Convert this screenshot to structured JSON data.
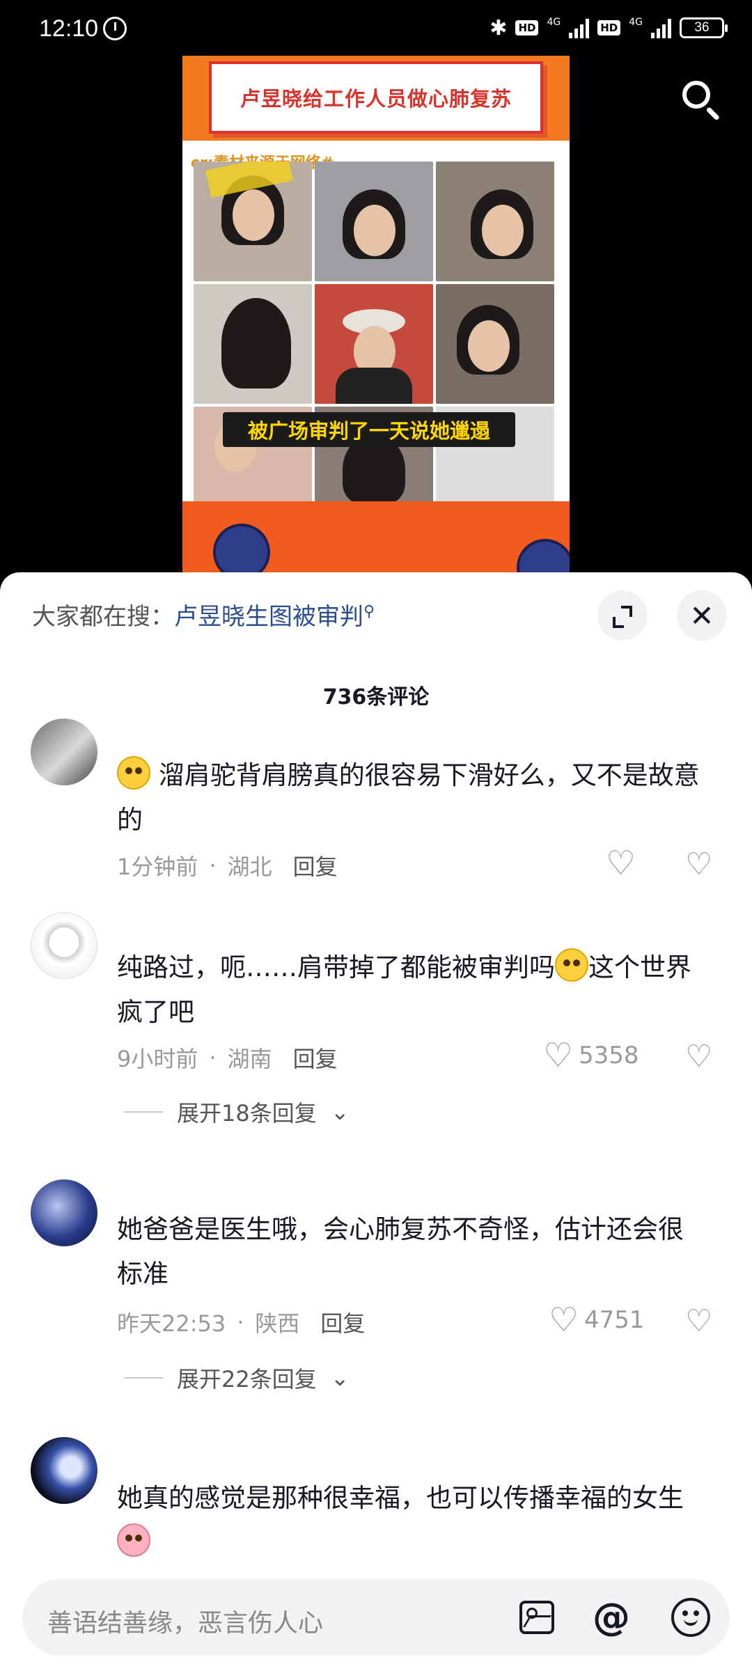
{
  "status_bar": {
    "time": "12:10",
    "network": "4G",
    "hd": "HD",
    "battery": "36"
  },
  "video": {
    "poster_title": "卢昱晓给工作人员做心肺复苏",
    "credit": "cr:素材来源于网络#",
    "caption": "被广场审判了一天说她邋遢"
  },
  "sheet": {
    "hot_search_prefix": "大家都在搜：",
    "hot_search_keyword": "卢昱晓生图被审判",
    "comment_count": "736条评论"
  },
  "comments": [
    {
      "text": "溜肩驼背肩膀真的很容易下滑好么，又不是故意的",
      "time": "1分钟前",
      "location": "湖北",
      "reply_label": "回复",
      "likes": ""
    },
    {
      "text_a": "纯路过，呃……肩带掉了都能被审判吗",
      "text_b": "这个世界疯了吧",
      "time": "9小时前",
      "location": "湖南",
      "reply_label": "回复",
      "likes": "5358",
      "expand": "展开18条回复"
    },
    {
      "text": "她爸爸是医生哦，会心肺复苏不奇怪，估计还会很标准",
      "time": "昨天22:53",
      "location": "陕西",
      "reply_label": "回复",
      "likes": "4751",
      "expand": "展开22条回复"
    },
    {
      "text": "她真的感觉是那种很幸福，也可以传播幸福的女生"
    }
  ],
  "input": {
    "placeholder": "善语结善缘，恶言伤人心"
  },
  "colors": {
    "accent_orange": "#f47a1f",
    "keyword_blue": "#2a4e8c",
    "sheet_bg": "#ffffff"
  },
  "icons": [
    "search-icon",
    "expand-icon",
    "close-icon",
    "heart-icon",
    "dislike-icon",
    "image-icon",
    "at-icon",
    "emoji-icon"
  ]
}
